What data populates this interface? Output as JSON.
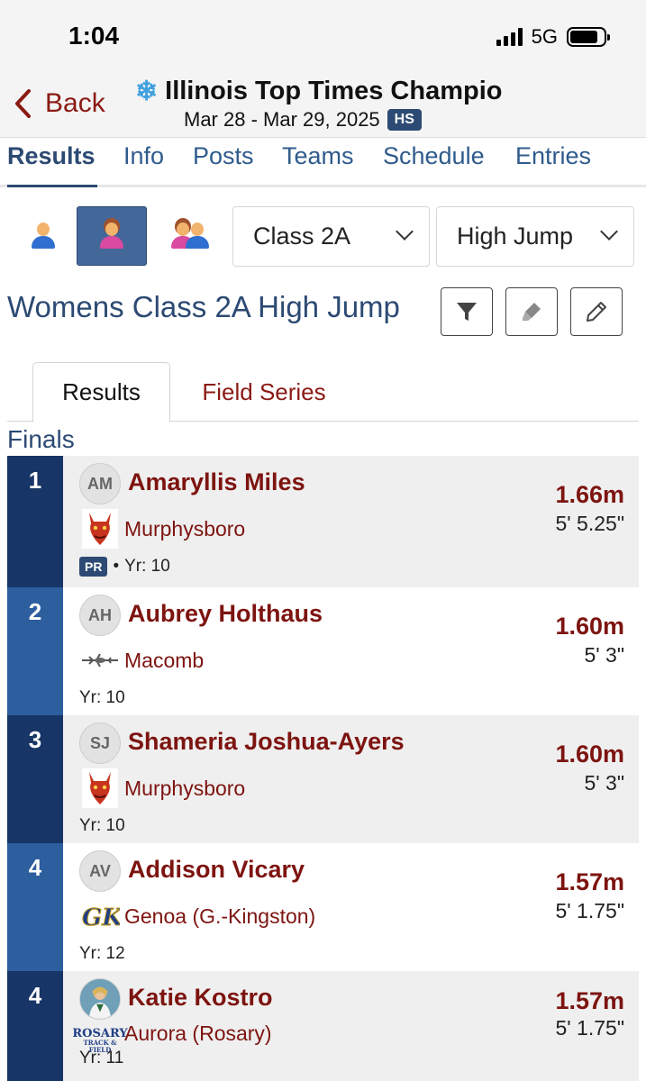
{
  "status_bar": {
    "time": "1:04",
    "network": "5G"
  },
  "nav": {
    "back_label": "Back",
    "meet_title": "Illinois Top Times Champio",
    "meet_dates": "Mar 28 - Mar 29, 2025",
    "level_badge": "HS"
  },
  "tabs": [
    {
      "label": "Results",
      "active": true
    },
    {
      "label": "Info"
    },
    {
      "label": "Posts"
    },
    {
      "label": "Teams"
    },
    {
      "label": "Schedule"
    },
    {
      "label": "Entries"
    }
  ],
  "filters": {
    "gender_options": [
      "mens",
      "womens",
      "all"
    ],
    "selected_gender": "womens",
    "class_select": "Class 2A",
    "event_select": "High Jump"
  },
  "event_title": "Womens Class 2A High Jump",
  "subtabs": {
    "results": "Results",
    "field_series": "Field Series"
  },
  "section_label": "Finals",
  "results": [
    {
      "place": "1",
      "initials": "AM",
      "name": "Amaryllis Miles",
      "team": "Murphysboro",
      "pr": "PR",
      "year": "Yr: 10",
      "mark": "1.66m",
      "imperial": "5' 5.25\""
    },
    {
      "place": "2",
      "initials": "AH",
      "name": "Aubrey Holthaus",
      "team": "Macomb",
      "year": "Yr: 10",
      "mark": "1.60m",
      "imperial": "5' 3\""
    },
    {
      "place": "3",
      "initials": "SJ",
      "name": "Shameria Joshua-Ayers",
      "team": "Murphysboro",
      "year": "Yr: 10",
      "mark": "1.60m",
      "imperial": "5' 3\""
    },
    {
      "place": "4",
      "initials": "AV",
      "name": "Addison Vicary",
      "team": "Genoa (G.-Kingston)",
      "year": "Yr: 12",
      "mark": "1.57m",
      "imperial": "5' 1.75\""
    },
    {
      "place": "4",
      "initials": "",
      "name": "Katie Kostro",
      "team": "Aurora (Rosary)",
      "year": "Yr: 11",
      "mark": "1.57m",
      "imperial": "5' 1.75\"",
      "logo_text": "ROSARY"
    }
  ],
  "colors": {
    "accent_navy": "#2c4a73",
    "team_red": "#7d1410",
    "place_dark": "#173566",
    "place_light": "#2d5e9e"
  }
}
